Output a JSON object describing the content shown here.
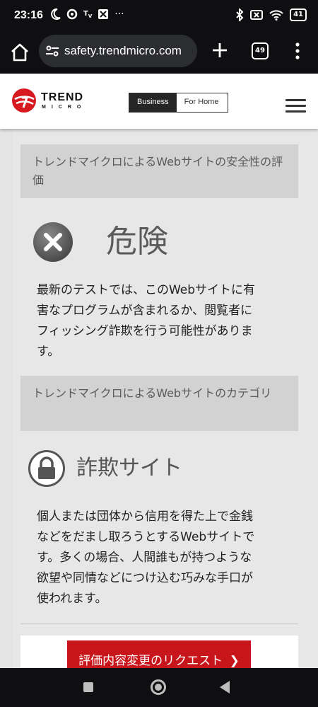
{
  "status_bar": {
    "time": "23:16",
    "battery": "41"
  },
  "browser": {
    "url": "safety.trendmicro.com",
    "tab_count": "49"
  },
  "site_header": {
    "logo_word": "TREND",
    "logo_sub": "MICRO",
    "segment_business": "Business",
    "segment_home": "For Home"
  },
  "content": {
    "safety_heading": "トレンドマイクロによるWebサイトの安全性の評価",
    "rating_label": "危険",
    "rating_description": "最新のテストでは、このWebサイトに有害なプログラムが含まれるか、閲覧者にフィッシング詐欺を行う可能性があります。",
    "category_heading": "トレンドマイクロによるWebサイトのカテゴリ",
    "category_label": "詐欺サイト",
    "category_description": "個人または団体から信用を得た上で金銭などをだまし取ろうとするWebサイトです。多くの場合、人間誰もが持つような欲望や同情などにつけ込む巧みな手口が使われます。",
    "request_button": "評価内容変更のリクエスト"
  },
  "colors": {
    "brand_red": "#d71920",
    "button_red": "#c8151b",
    "band_gray": "#d2d2d2"
  }
}
